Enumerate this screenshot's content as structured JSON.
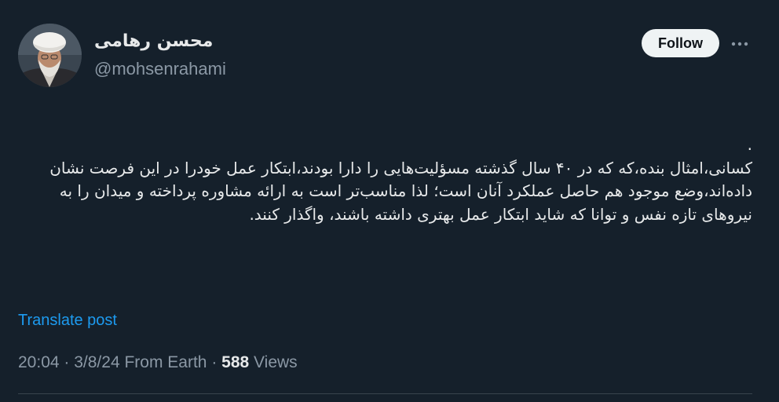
{
  "author": {
    "name": "محسن رهامی",
    "handle": "@mohsenrahami"
  },
  "header": {
    "follow_label": "Follow",
    "more_icon": "more-horizontal-icon"
  },
  "tweet": {
    "leading": ".",
    "text": "کسانی،امثال بنده،که که در ۴۰ سال گذشته مسؤلیت‌هایی را دارا بودند،ابتکار عمل خودرا در این فرصت نشان داده‌اند،وضع موجود هم حاصل عملکرد آنان است؛ لذا مناسب‌تر است به ارائه مشاوره پرداخته و میدان را به نیروهای تازه نفس و توانا که شاید ابتکار عمل بهتری داشته باشند، واگذار کنند."
  },
  "translate_label": "Translate post",
  "meta": {
    "time": "20:04",
    "sep1": " · ",
    "date": "3/8/24",
    "source": " From Earth",
    "sep2": " · ",
    "views_count": "588",
    "views_label": " Views"
  },
  "colors": {
    "background": "#15202b",
    "text": "#e7e9ea",
    "secondary": "#8b98a5",
    "link": "#1d9bf0",
    "follow_bg": "#eff3f4"
  }
}
